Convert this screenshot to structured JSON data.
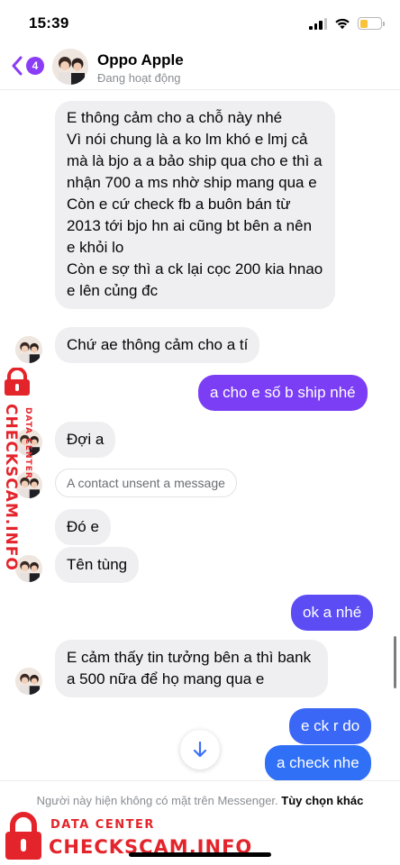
{
  "status_bar": {
    "time": "15:39",
    "battery_level": 0.38
  },
  "header": {
    "unread_count": "4",
    "name": "Oppo Apple",
    "status": "Đang hoạt động"
  },
  "messages": [
    {
      "side": "in",
      "text": "E thông cảm cho a chỗ này nhé\nVì nói chung là a ko lm khó e lmj cả mà là bjo a a bảo ship qua cho e thì a nhận 700 a ms nhờ ship mang qua e\nCòn e cứ check fb a buôn bán từ 2013 tới bjo hn ai cũng bt bên a nên e khỏi lo\nCòn e sợ thì a ck lại cọc 200 kia hnao e lên củng đc"
    },
    {
      "side": "in",
      "text": "Chứ ae thông cảm cho a tí"
    },
    {
      "side": "out",
      "text": "a cho e số b ship nhé"
    },
    {
      "side": "in",
      "text": "Đợi a"
    },
    {
      "side": "unsent",
      "text": "A contact unsent a message"
    },
    {
      "side": "in",
      "text": "Đó e"
    },
    {
      "side": "in",
      "text": "Tên tùng"
    },
    {
      "side": "out",
      "text": "ok a nhé"
    },
    {
      "side": "in",
      "text": "E cảm thấy tin tưởng bên a thì bank a 500 nữa để họ mang qua e"
    },
    {
      "side": "out",
      "text": "e ck r do"
    },
    {
      "side": "out",
      "text": "a check nhe"
    }
  ],
  "footer": {
    "note": "Người này hiện không có mặt trên Messenger.",
    "options_link": "Tùy chọn khác"
  },
  "watermark": {
    "side_text": "CHECKSCAM.INFO",
    "side_small": "DATA CENTER",
    "bottom_line1": "DATA CENTER",
    "bottom_line2": "CHECKSCAM.INFO"
  },
  "colors": {
    "accent": "#8b3cf7",
    "outgoing_top": "#8b39f2",
    "outgoing_mid": "#5e4df2",
    "outgoing_bottom": "#2f6ff7",
    "incoming": "#efeff1",
    "watermark_red": "#e4242b"
  },
  "icons": {
    "back": "chevron-left-icon",
    "scroll_down": "arrow-down-icon",
    "signal": "cellular-signal-icon",
    "wifi": "wifi-icon",
    "battery": "battery-icon",
    "watermark_lock": "lock-icon"
  }
}
